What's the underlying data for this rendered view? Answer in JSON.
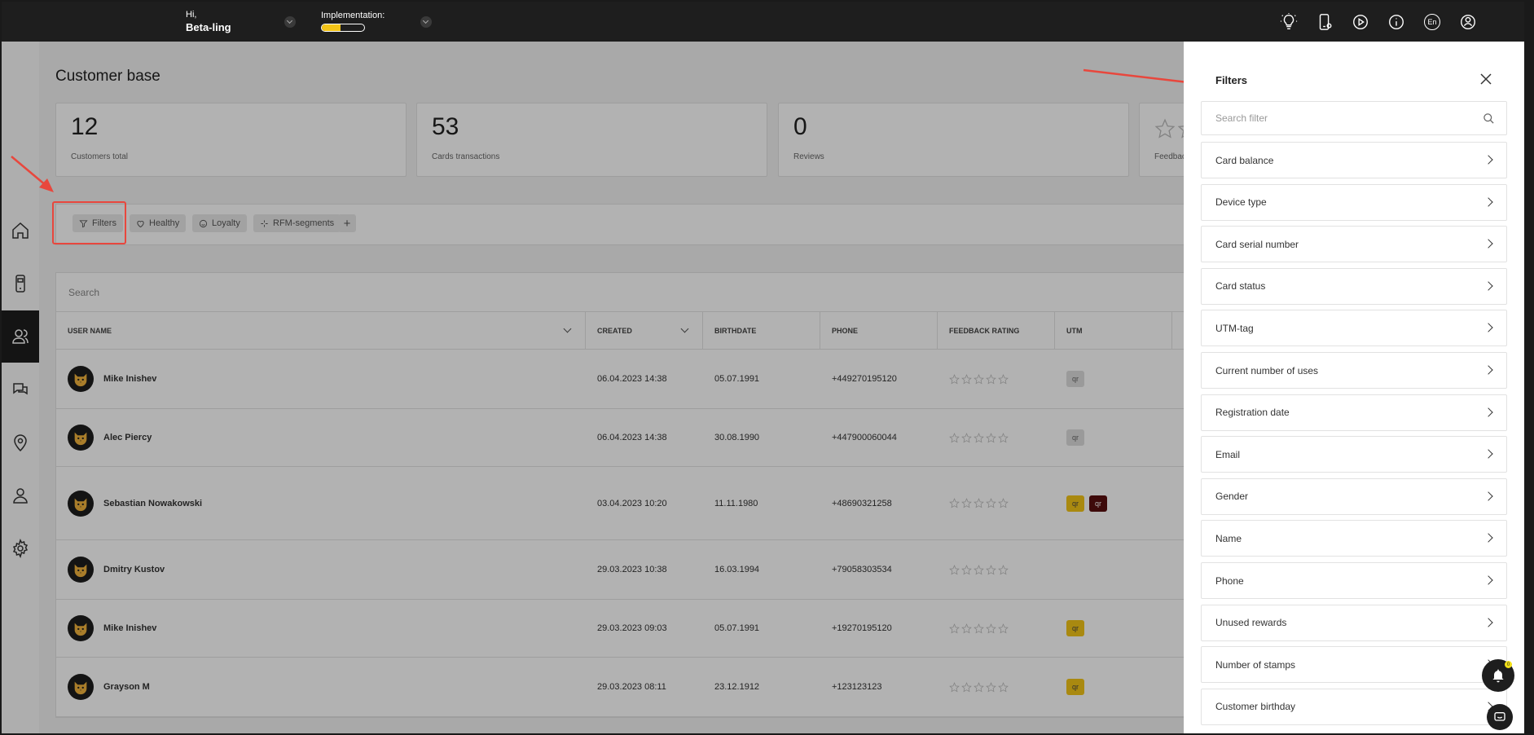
{
  "header": {
    "greeting": "Hi,",
    "user_name": "Beta-ling",
    "implementation_label": "Implementation:",
    "implementation_progress": 0.45,
    "language": "En",
    "icons": [
      "lightbulb-icon",
      "phone-icon",
      "play-icon",
      "info-icon",
      "language-icon",
      "account-icon"
    ]
  },
  "sidebar": {
    "items": [
      {
        "name": "home",
        "icon": "home-icon"
      },
      {
        "name": "cards",
        "icon": "mobile-card-icon"
      },
      {
        "name": "customers",
        "icon": "customers-icon",
        "active": true
      },
      {
        "name": "messages",
        "icon": "chat-icon"
      },
      {
        "name": "locations",
        "icon": "location-icon"
      },
      {
        "name": "users",
        "icon": "user-icon"
      },
      {
        "name": "settings",
        "icon": "gear-icon"
      }
    ]
  },
  "main": {
    "title": "Customer base",
    "stats": [
      {
        "value": "12",
        "label": "Customers total"
      },
      {
        "value": "53",
        "label": "Cards transactions"
      },
      {
        "value": "0",
        "label": "Reviews"
      },
      {
        "value": "",
        "label": "Feedbac"
      }
    ],
    "chips": [
      "Filters",
      "Healthy",
      "Loyalty",
      "RFM-segments"
    ],
    "chip_add": "+",
    "search_placeholder": "Search",
    "columns": [
      "USER NAME",
      "CREATED",
      "BIRTHDATE",
      "PHONE",
      "FEEDBACK RATING",
      "UTM"
    ],
    "rows": [
      {
        "name": "Mike Inishev",
        "created": "06.04.2023 14:38",
        "birthdate": "05.07.1991",
        "phone": "+449270195120",
        "utm": [
          {
            "t": "qr",
            "s": "g"
          }
        ]
      },
      {
        "name": "Alec Piercy",
        "created": "06.04.2023 14:38",
        "birthdate": "30.08.1990",
        "phone": "+447900060044",
        "utm": [
          {
            "t": "qr",
            "s": "g"
          }
        ]
      },
      {
        "name": "Sebastian Nowakowski",
        "created": "03.04.2023 10:20",
        "birthdate": "11.11.1980",
        "phone": "+48690321258",
        "utm": [
          {
            "t": "qr",
            "s": "y"
          },
          {
            "t": "qr",
            "s": "d"
          }
        ]
      },
      {
        "name": "Dmitry Kustov",
        "created": "29.03.2023 10:38",
        "birthdate": "16.03.1994",
        "phone": "+79058303534",
        "utm": []
      },
      {
        "name": "Mike Inishev",
        "created": "29.03.2023 09:03",
        "birthdate": "05.07.1991",
        "phone": "+19270195120",
        "utm": [
          {
            "t": "qr",
            "s": "y"
          }
        ]
      },
      {
        "name": "Grayson M",
        "created": "29.03.2023 08:11",
        "birthdate": "23.12.1912",
        "phone": "+123123123",
        "utm": [
          {
            "t": "qr",
            "s": "y"
          }
        ]
      }
    ]
  },
  "filters_panel": {
    "title": "Filters",
    "search_placeholder": "Search filter",
    "items": [
      "Card balance",
      "Device type",
      "Card serial number",
      "Card status",
      "UTM-tag",
      "Current number of uses",
      "Registration date",
      "Email",
      "Gender",
      "Name",
      "Phone",
      "Unused rewards",
      "Number of stamps",
      "Customer birthday"
    ]
  },
  "notifications": {
    "badge": "0"
  },
  "colors": {
    "accent": "#f3c417",
    "dark": "#1e1e1e",
    "annotation": "#e8473d"
  }
}
